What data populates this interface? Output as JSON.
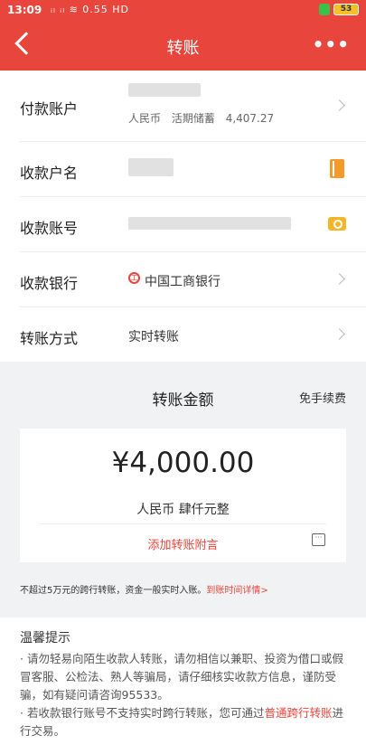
{
  "status_bar": {
    "time": "13:09",
    "indicators": "ᵢₗ ᵢₗ ≋ 0.55 HD",
    "battery": "53"
  },
  "nav": {
    "title": "转账"
  },
  "form": {
    "payer": {
      "label": "付款账户",
      "currency": "人民币",
      "account_type": "活期储蓄",
      "balance": "4,407.27"
    },
    "payee_name": {
      "label": "收款户名"
    },
    "payee_account": {
      "label": "收款账号"
    },
    "payee_bank": {
      "label": "收款银行",
      "value": "中国工商银行",
      "logo": "工"
    },
    "method": {
      "label": "转账方式",
      "value": "实时转账"
    }
  },
  "amount": {
    "title": "转账金额",
    "fee": "免手续费",
    "value": "¥4,000.00",
    "words": "人民币  肆仟元整",
    "attach": "添加转账附言"
  },
  "note": {
    "text": "不超过5万元的跨行转账，资金一般实时入账。",
    "link": "到账时间详情>"
  },
  "tips": {
    "title": "温馨提示",
    "item1": "· 请勿轻易向陌生收款人转账，请勿相信以兼职、投资为借口或假冒客服、公检法、熟人等骗局，请仔细核实收款方信息，谨防受骗，如有疑问请咨询95533。",
    "item2_pre": "· 若收款银行账号不支持实时跨行转账，您可通过",
    "item2_link": "普通跨行转账",
    "item2_post": "进行交易。"
  },
  "colors": {
    "primary": "#e8453c",
    "background": "#f1f2f4",
    "icon_orange": "#f39a2a"
  },
  "icons": [
    "back-icon",
    "more-icon",
    "chevron-right-icon",
    "contact-book-icon",
    "camera-icon",
    "bank-logo-icon",
    "message-icon"
  ]
}
